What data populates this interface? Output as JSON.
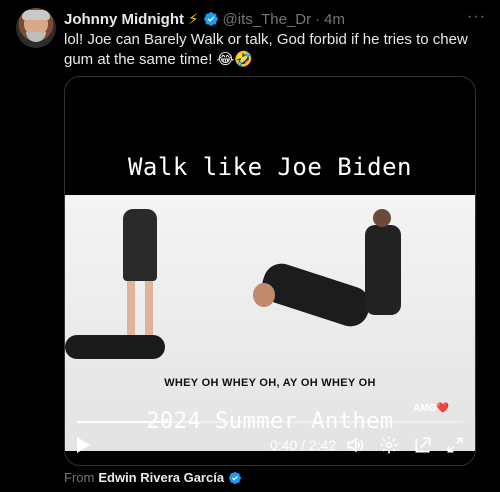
{
  "tweet": {
    "author_name": "Johnny Midnight",
    "author_emoji": "⚡",
    "handle": "@its_The_Dr",
    "separator": "·",
    "time": "4m",
    "more_label": "···",
    "text": "lol! Joe can Barely Walk or talk, God forbid if he tries to chew gum at the same time! 😂🤣"
  },
  "video": {
    "caption_top": "Walk like Joe Biden",
    "caption_mid": "WHEY OH WHEY OH, AY OH WHEY OH",
    "caption_bottom": "2024 Summer Anthem",
    "watermark": "AMG❤️",
    "timecode": "0:40 / 2:42",
    "progress": 0.247
  },
  "attribution": {
    "prefix": "From",
    "source": "Edwin Rivera García"
  },
  "colors": {
    "background": "#000000",
    "text": "#e7e9ea",
    "muted": "#71767b",
    "verified": "#1d9bf0",
    "bolt": "#f4c20d"
  }
}
